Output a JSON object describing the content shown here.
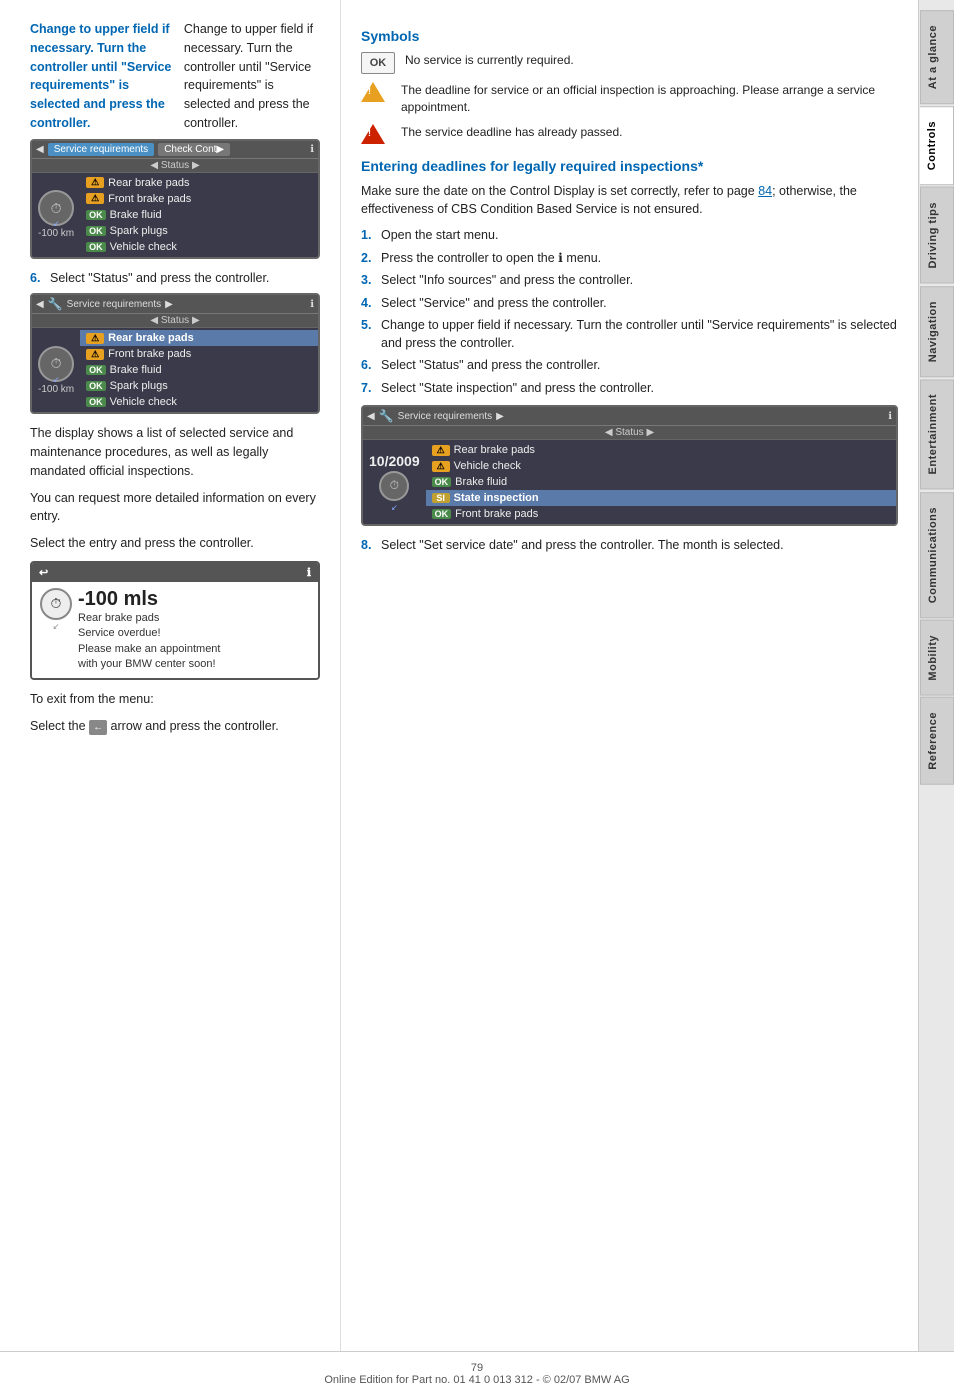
{
  "sidebar": {
    "tabs": [
      {
        "label": "At a glance",
        "active": false
      },
      {
        "label": "Controls",
        "active": true
      },
      {
        "label": "Driving tips",
        "active": false
      },
      {
        "label": "Navigation",
        "active": false
      },
      {
        "label": "Entertainment",
        "active": false
      },
      {
        "label": "Communications",
        "active": false
      },
      {
        "label": "Mobility",
        "active": false
      },
      {
        "label": "Reference",
        "active": false
      }
    ]
  },
  "left_col": {
    "step5_text": "Change to upper field if necessary. Turn the controller until \"Service requirements\" is selected and press the controller.",
    "screen1": {
      "tabs": [
        "Service requirements",
        "Check Cont▶"
      ],
      "status": "◀ Status ▶",
      "items": [
        {
          "badge": "⚠",
          "badge_type": "warn",
          "label": "Rear brake pads"
        },
        {
          "badge": "⚠",
          "badge_type": "warn",
          "label": "Front brake pads"
        },
        {
          "badge": "OK",
          "badge_type": "ok",
          "label": "Brake fluid"
        },
        {
          "badge": "OK",
          "badge_type": "ok",
          "label": "Spark plugs"
        },
        {
          "badge": "OK",
          "badge_type": "ok",
          "label": "Vehicle check"
        }
      ],
      "mileage": "-100 km"
    },
    "step6_text": "Select \"Status\" and press the controller.",
    "screen2": {
      "header": "◀ 🔧 Service requirements ▶",
      "status": "◀ Status ▶",
      "items": [
        {
          "badge": "⚠",
          "badge_type": "warn",
          "label": "Rear brake pads",
          "highlighted": true
        },
        {
          "badge": "⚠",
          "badge_type": "warn",
          "label": "Front brake pads"
        },
        {
          "badge": "OK",
          "badge_type": "ok",
          "label": "Brake fluid"
        },
        {
          "badge": "OK",
          "badge_type": "ok",
          "label": "Spark plugs"
        },
        {
          "badge": "OK",
          "badge_type": "ok",
          "label": "Vehicle check"
        }
      ],
      "mileage": "-100 km"
    },
    "display_para1": "The display shows a list of selected service and maintenance procedures, as well as legally mandated official inspections.",
    "display_para2": "You can request more detailed information on every entry.",
    "display_para3": "Select the entry and press the controller.",
    "screen3": {
      "icon": "⊙",
      "mileage": "-100 mls",
      "lines": [
        "Rear brake pads",
        "Service overdue!",
        "Please make an appointment",
        "with your BMW center soon!"
      ]
    },
    "exit_label": "To exit from the menu:",
    "exit_instruction": "Select the ← arrow and press the controller."
  },
  "right_col": {
    "symbols_heading": "Symbols",
    "symbols": [
      {
        "type": "ok_box",
        "label": "OK",
        "text": "No service is currently required."
      },
      {
        "type": "triangle_warn",
        "text": "The deadline for service or an official inspection is approaching. Please arrange a service appointment."
      },
      {
        "type": "triangle_red",
        "text": "The service deadline has already passed."
      }
    ],
    "section_heading": "Entering deadlines for legally required inspections*",
    "intro_para": "Make sure the date on the Control Display is set correctly, refer to page 84; otherwise, the effectiveness of CBS Condition Based Service is not ensured.",
    "steps": [
      {
        "num": "1.",
        "text": "Open the start menu."
      },
      {
        "num": "2.",
        "text": "Press the controller to open the ℹ menu."
      },
      {
        "num": "3.",
        "text": "Select \"Info sources\" and press the controller."
      },
      {
        "num": "4.",
        "text": "Select \"Service\" and press the controller."
      },
      {
        "num": "5.",
        "text": "Change to upper field if necessary. Turn the controller until \"Service requirements\" is selected and press the controller."
      },
      {
        "num": "6.",
        "text": "Select \"Status\" and press the controller."
      },
      {
        "num": "7.",
        "text": "Select \"State inspection\" and press the controller."
      }
    ],
    "screen4": {
      "header": "◀ 🔧 Service requirements ▶",
      "status": "◀ Status ▶",
      "date": "10/2009",
      "items": [
        {
          "badge": "⚠",
          "badge_type": "warn",
          "label": "Rear brake pads"
        },
        {
          "badge": "⚠",
          "badge_type": "warn",
          "label": "Vehicle check"
        },
        {
          "badge": "OK",
          "badge_type": "ok",
          "label": "Brake fluid"
        },
        {
          "badge": "SI",
          "badge_type": "state",
          "label": "State inspection",
          "highlighted": true
        },
        {
          "badge": "OK",
          "badge_type": "ok",
          "label": "Front brake pads"
        }
      ]
    },
    "step8": {
      "num": "8.",
      "text": "Select \"Set service date\" and press the controller. The month is selected."
    }
  },
  "footer": {
    "page_num": "79",
    "copyright": "Online Edition for Part no. 01 41 0 013 312 - © 02/07 BMW AG"
  }
}
